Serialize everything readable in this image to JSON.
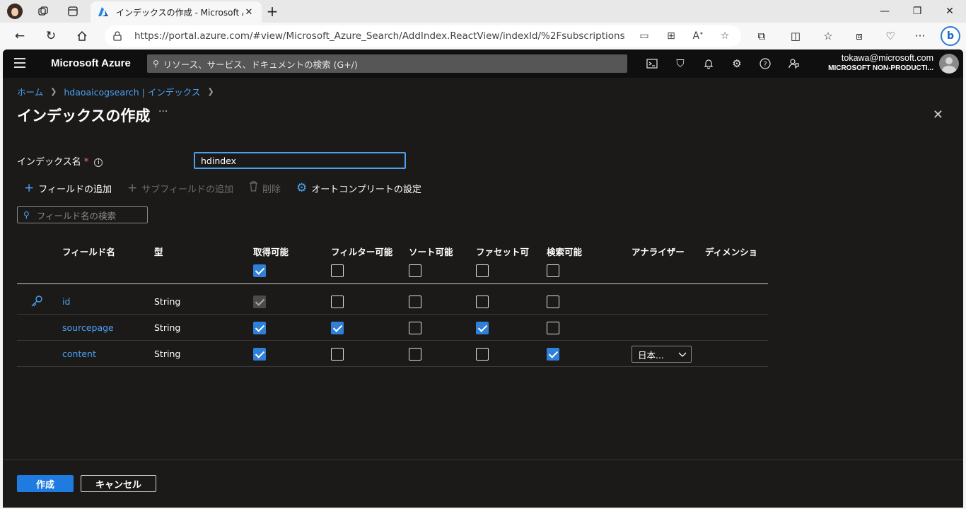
{
  "browser": {
    "tab_title": "インデックスの作成 - Microsoft Azure",
    "new_tab_symbol": "+",
    "url": "https://portal.azure.com/#view/Microsoft_Azure_Search/AddIndex.ReactView/indexId/%2Fsubscriptions%2F77..."
  },
  "portal": {
    "brand": "Microsoft Azure",
    "search_placeholder": "リソース、サービス、ドキュメントの検索 (G+/)",
    "user_email": "tokawa@microsoft.com",
    "user_tenant": "MICROSOFT NON-PRODUCTI..."
  },
  "breadcrumb": [
    "ホーム",
    "hdaoaicogsearch | インデックス"
  ],
  "page": {
    "title": "インデックスの作成",
    "more_label": "···",
    "close_label": "✕"
  },
  "form": {
    "index_name_label": "インデックス名",
    "required_mark": "*",
    "info_symbol": "i",
    "index_name_value": "hdindex"
  },
  "commands": {
    "add_field": "フィールドの追加",
    "add_subfield": "サブフィールドの追加",
    "delete": "削除",
    "autocomplete": "オートコンプリートの設定"
  },
  "filter_placeholder": "フィールド名の検索",
  "table": {
    "headers": {
      "field_name": "フィールド名",
      "type": "型",
      "retrievable": "取得可能",
      "filterable": "フィルター可能",
      "sortable": "ソート可能",
      "facetable": "ファセット可",
      "searchable": "検索可能",
      "analyzer": "アナライザー",
      "dimensions": "ディメンショ"
    },
    "header_checks": {
      "retrievable": true,
      "filterable": false,
      "sortable": false,
      "facetable": false,
      "searchable": false
    },
    "rows": [
      {
        "name": "id",
        "type": "String",
        "key": true,
        "retrievable": "disabled",
        "filterable": false,
        "sortable": false,
        "facetable": false,
        "searchable": false,
        "analyzer": ""
      },
      {
        "name": "sourcepage",
        "type": "String",
        "key": false,
        "retrievable": true,
        "filterable": true,
        "sortable": false,
        "facetable": true,
        "searchable": false,
        "analyzer": ""
      },
      {
        "name": "content",
        "type": "String",
        "key": false,
        "retrievable": true,
        "filterable": false,
        "sortable": false,
        "facetable": false,
        "searchable": true,
        "analyzer": "日本..."
      }
    ]
  },
  "footer": {
    "create": "作成",
    "cancel": "キャンセル"
  },
  "colors": {
    "accent": "#4ba0f2",
    "primary_button": "#1f7be0",
    "checked": "#2f80d8",
    "background": "#1b1a19"
  }
}
